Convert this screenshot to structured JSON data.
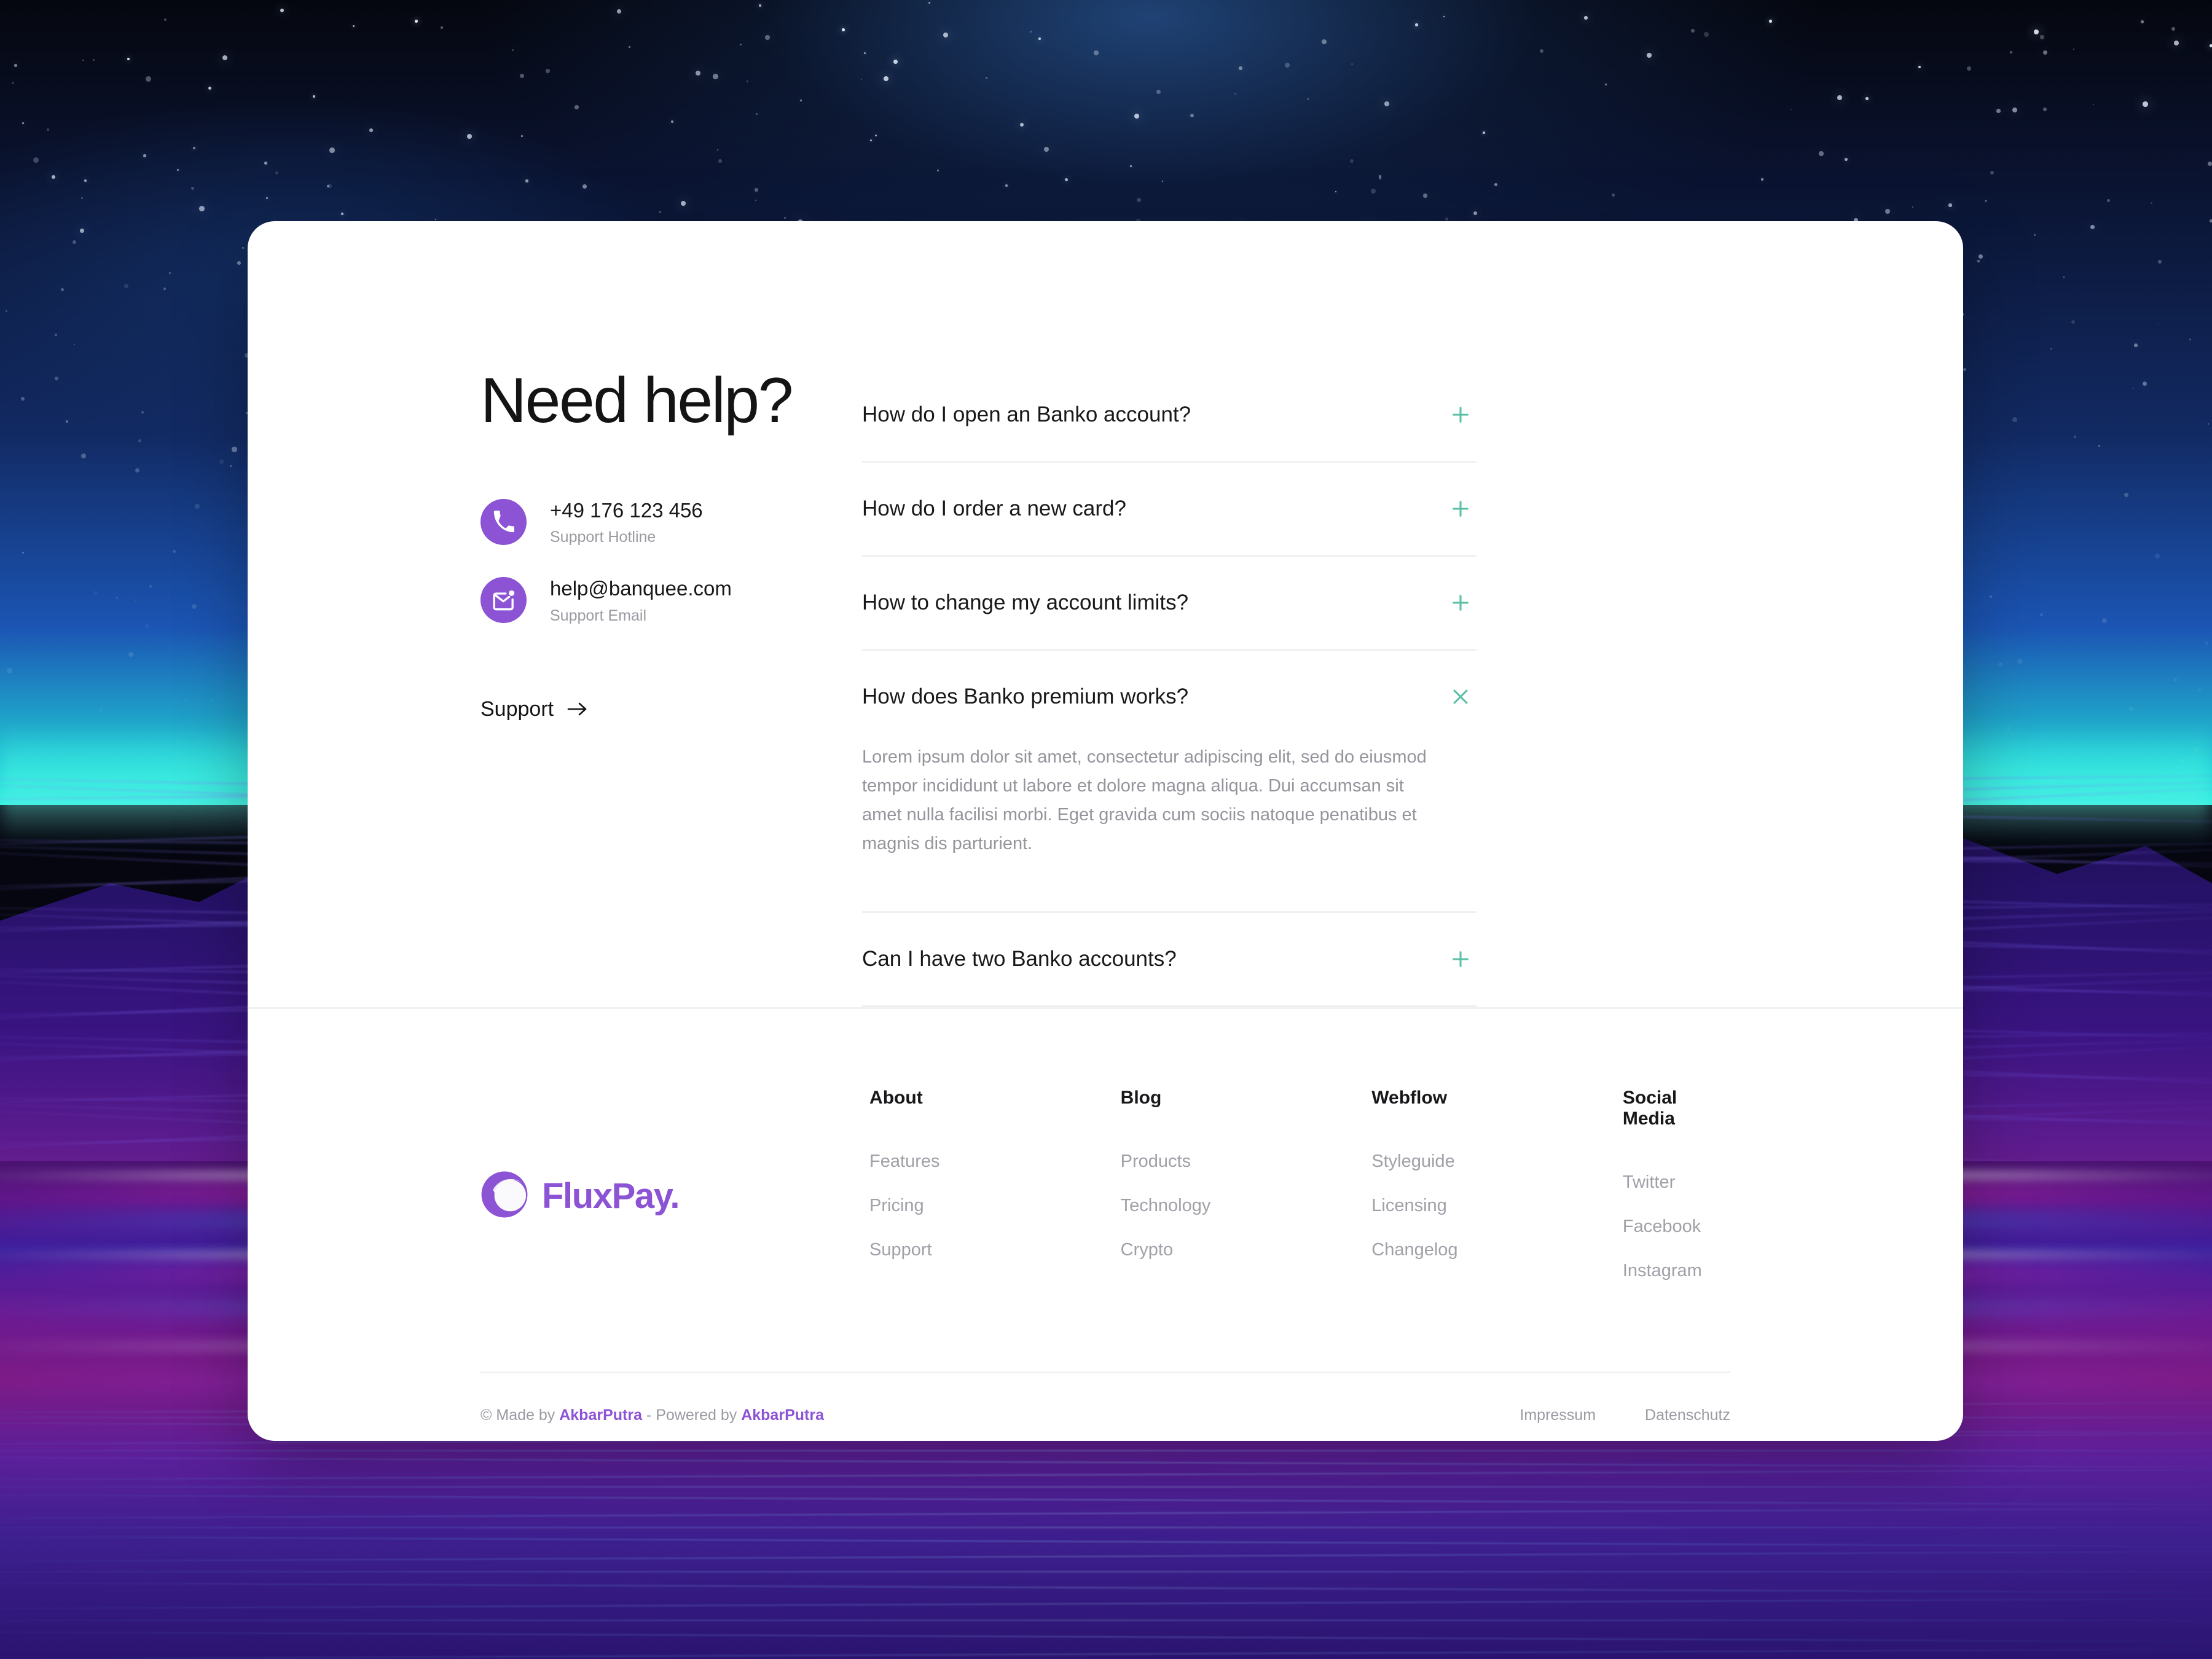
{
  "help": {
    "title": "Need help?",
    "contacts": [
      {
        "icon": "phone-icon",
        "value": "+49 176 123 456",
        "label": "Support Hotline"
      },
      {
        "icon": "mail-icon",
        "value": "help@banquee.com",
        "label": "Support Email"
      }
    ],
    "support_link": "Support"
  },
  "faq": {
    "items": [
      {
        "question": "How do I open an Banko account?",
        "expanded": false,
        "toggle_icon": "plus-icon",
        "answer": ""
      },
      {
        "question": "How do I order a new card?",
        "expanded": false,
        "toggle_icon": "plus-icon",
        "answer": ""
      },
      {
        "question": "How to change my account limits?",
        "expanded": false,
        "toggle_icon": "plus-icon",
        "answer": ""
      },
      {
        "question": "How does Banko premium works?",
        "expanded": true,
        "toggle_icon": "close-icon",
        "answer": "Lorem ipsum dolor sit amet, consectetur adipiscing elit, sed do eiusmod tempor incididunt ut labore et dolore magna aliqua. Dui accumsan sit amet nulla facilisi morbi. Eget gravida cum sociis natoque penatibus et magnis dis parturient."
      },
      {
        "question": "Can I have two Banko accounts?",
        "expanded": false,
        "toggle_icon": "plus-icon",
        "answer": ""
      }
    ]
  },
  "footer": {
    "brand": "FluxPay.",
    "columns": [
      {
        "heading": "About",
        "links": [
          "Features",
          "Pricing",
          "Support"
        ]
      },
      {
        "heading": "Blog",
        "links": [
          "Products",
          "Technology",
          "Crypto"
        ]
      },
      {
        "heading": "Webflow",
        "links": [
          "Styleguide",
          "Licensing",
          "Changelog"
        ]
      },
      {
        "heading": "Social Media",
        "links": [
          "Twitter",
          "Facebook",
          "Instagram"
        ]
      }
    ],
    "credits": {
      "symbol": "©",
      "made_by_prefix": "Made by",
      "made_by_name": "AkbarPutra",
      "separator": "-",
      "powered_by_prefix": "Powered by",
      "powered_by_name": "AkbarPutra"
    },
    "legal": [
      "Impressum",
      "Datenschutz"
    ]
  },
  "colors": {
    "brand_purple": "#8c53d4",
    "accent_teal": "#5cbfa8",
    "text_dark": "#18181b",
    "text_muted": "#9a9aa2"
  }
}
